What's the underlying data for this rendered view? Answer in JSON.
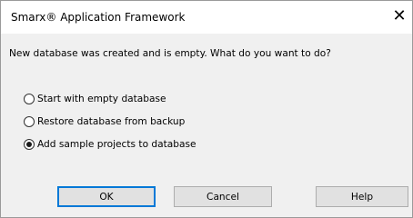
{
  "window": {
    "title": "Smarx® Application Framework",
    "close_glyph": "✕"
  },
  "message": "New database was created and is empty. What do you want to do?",
  "options": [
    {
      "label": "Start with empty database",
      "selected": false
    },
    {
      "label": "Restore database from backup",
      "selected": false
    },
    {
      "label": "Add sample projects to database",
      "selected": true
    }
  ],
  "buttons": {
    "ok": "OK",
    "cancel": "Cancel",
    "help": "Help"
  },
  "colors": {
    "dialog_background": "#f0f0f0",
    "titlebar_background": "#ffffff",
    "button_face": "#e1e1e1",
    "default_button_border": "#0078d7"
  },
  "icons": {
    "close": "close-icon",
    "radio_unselected": "radio-unselected-icon",
    "radio_selected": "radio-selected-icon"
  }
}
